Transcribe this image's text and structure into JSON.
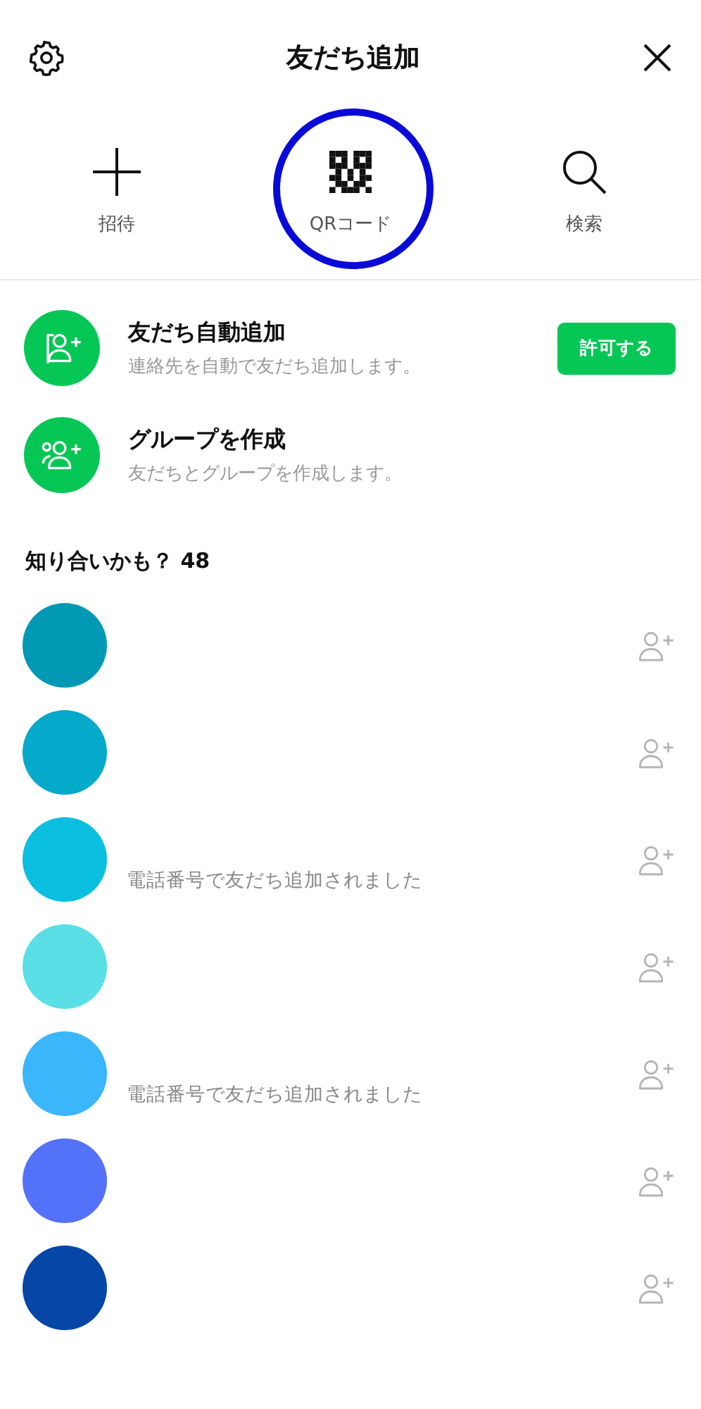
{
  "header": {
    "title": "友だち追加"
  },
  "actions": [
    {
      "kind": "add",
      "label": "招待",
      "highlighted": false
    },
    {
      "kind": "qr",
      "label": "QRコード",
      "highlighted": true
    },
    {
      "kind": "search",
      "label": "検索",
      "highlighted": false
    }
  ],
  "features": [
    {
      "kind": "auto",
      "title": "友だち自動追加",
      "subtitle": "連絡先を自動で友だち追加します。",
      "button": "許可する"
    },
    {
      "kind": "group",
      "title": "グループを作成",
      "subtitle": "友だちとグループを作成します。"
    }
  ],
  "suggestions": {
    "heading": "知り合いかも？ 48",
    "people": [
      {
        "color": "#0199b4"
      },
      {
        "color": "#05a9c9"
      },
      {
        "color": "#0bbfe0",
        "note": "電話番号で友だち追加されました"
      },
      {
        "color": "#5adfe6"
      },
      {
        "color": "#3bb6fb",
        "note": "電話番号で友だち追加されました"
      },
      {
        "color": "#5471f9"
      },
      {
        "color": "#0546a7"
      }
    ]
  }
}
